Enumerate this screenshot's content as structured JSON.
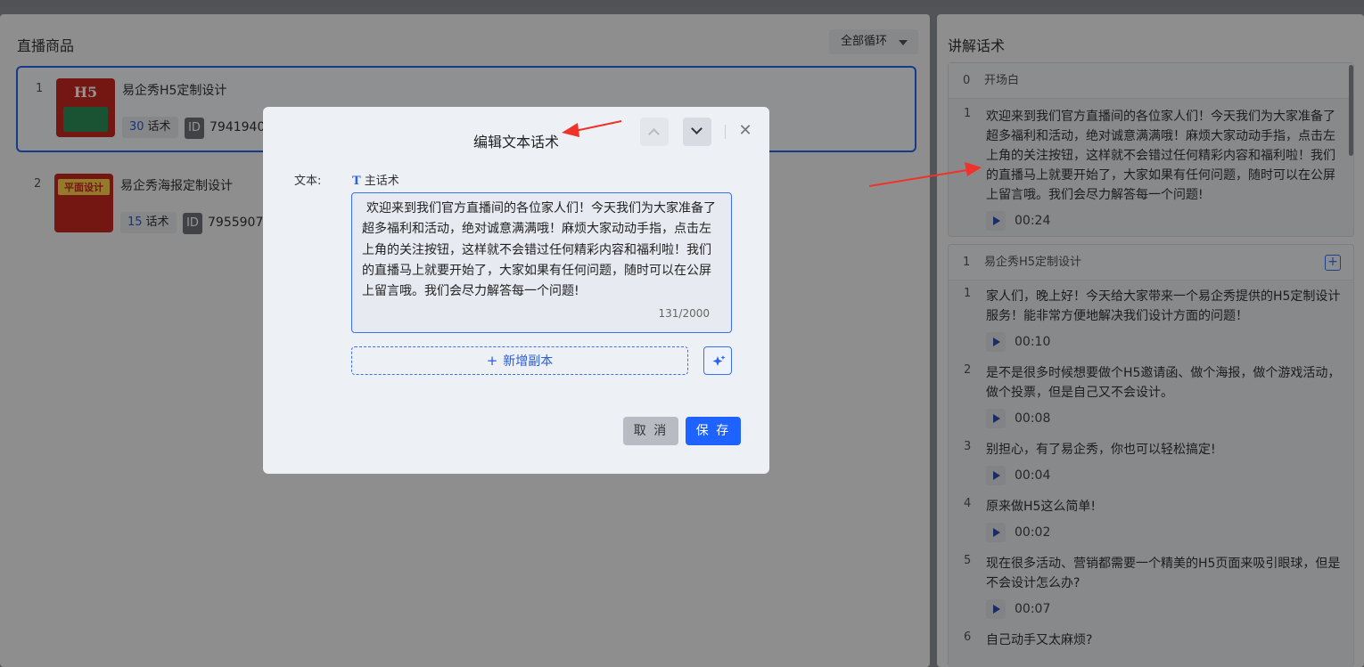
{
  "left_panel": {
    "title": "直播商品",
    "loop_select": "全部循环",
    "products": [
      {
        "index": "1",
        "name": "易企秀H5定制设计",
        "script_count": "30",
        "script_unit": "话术",
        "id_label": "ID",
        "id_value": "7941940",
        "thumb_text": "H5"
      },
      {
        "index": "2",
        "name": "易企秀海报定制设计",
        "script_count": "15",
        "script_unit": "话术",
        "id_label": "ID",
        "id_value": "7955907",
        "thumb_text": "平面设计"
      }
    ]
  },
  "right_panel": {
    "title": "讲解话术",
    "opening": {
      "index": "0",
      "title": "开场白",
      "items": [
        {
          "index": "1",
          "text": "欢迎来到我们官方直播间的各位家人们！今天我们为大家准备了超多福利和活动，绝对诚意满满哦！麻烦大家动动手指，点击左上角的关注按钮，这样就不会错过任何精彩内容和福利啦！我们的直播马上就要开始了，大家如果有任何问题，随时可以在公屏上留言哦。我们会尽力解答每一个问题!",
          "duration": "00:24"
        }
      ]
    },
    "product_group": {
      "index": "1",
      "title": "易企秀H5定制设计",
      "add_icon": "plus-square-icon",
      "items": [
        {
          "index": "1",
          "text": "家人们，晚上好！今天给大家带来一个易企秀提供的H5定制设计服务！能非常方便地解决我们设计方面的问题！",
          "duration": "00:10"
        },
        {
          "index": "2",
          "text": "是不是很多时候想要做个H5邀请函、做个海报，做个游戏活动，做个投票，但是自己又不会设计。",
          "duration": "00:08"
        },
        {
          "index": "3",
          "text": "别担心，有了易企秀，你也可以轻松搞定!",
          "duration": "00:04"
        },
        {
          "index": "4",
          "text": "原来做H5这么简单!",
          "duration": "00:02"
        },
        {
          "index": "5",
          "text": "现在很多活动、营销都需要一个精美的H5页面来吸引眼球，但是不会设计怎么办?",
          "duration": "00:07"
        },
        {
          "index": "6",
          "text": "自己动手又太麻烦?",
          "duration": ""
        }
      ]
    }
  },
  "modal": {
    "title": "编辑文本话术",
    "field_label": "文本:",
    "main_tag": "主话术",
    "main_tag_icon": "T",
    "text": "欢迎来到我们官方直播间的各位家人们！今天我们为大家准备了超多福利和活动，绝对诚意满满哦！麻烦大家动动手指，点击左上角的关注按钮，这样就不会错过任何精彩内容和福利啦！我们的直播马上就要开始了，大家如果有任何问题，随时可以在公屏上留言哦。我们会尽力解答每一个问题!",
    "counter": "131/2000",
    "add_copy": "新增副本",
    "cancel": "取 消",
    "save": "保 存",
    "close_icon": "close-icon"
  },
  "colors": {
    "accent": "#1e63ff",
    "annotation_arrow": "#f0322a"
  }
}
